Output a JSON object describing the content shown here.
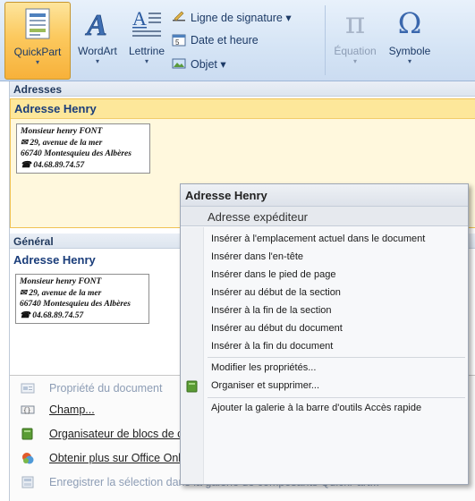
{
  "ribbon": {
    "quickpart": {
      "label": "QuickPart",
      "arrow": "▾"
    },
    "wordart": {
      "label": "WordArt",
      "arrow": "▾"
    },
    "lettrine": {
      "label": "Lettrine",
      "arrow": "▾"
    },
    "small_buttons": [
      "Ligne de signature ▾",
      "Date et heure",
      "Objet ▾"
    ],
    "equation": {
      "label": "Équation",
      "arrow": "▾"
    },
    "symbole": {
      "label": "Symbole",
      "arrow": "▾"
    },
    "pi_glyph": "π",
    "omega_glyph": "Ω"
  },
  "gallery": {
    "section_adresses": "Adresses",
    "section_general": "Général",
    "entry_title_1": "Adresse Henry",
    "entry_title_2": "Adresse Henry",
    "preview_lines": [
      "Monsieur henry FONT",
      "29, avenue de la mer",
      "66740 Montesquieu des Albères",
      "04.68.89.74.57"
    ],
    "preview_icons": [
      "✉",
      "☎"
    ]
  },
  "context_menu": {
    "title": "Adresse Henry",
    "subtitle": "Adresse expéditeur",
    "items": [
      "Insérer à l'emplacement actuel dans le document",
      "Insérer dans l'en-tête",
      "Insérer dans le pied de page",
      "Insérer au début de la section",
      "Insérer à la fin de la section",
      "Insérer au début du document",
      "Insérer à la fin du document",
      "Modifier les propriétés...",
      "Organiser et supprimer...",
      "Ajouter la galerie à la barre d'outils Accès rapide"
    ]
  },
  "bottom_menu": {
    "items": [
      "Propriété du document",
      "Champ...",
      "Organisateur de blocs de construction...",
      "Obtenir plus sur Office Online...",
      "Enregistrer la sélection dans la galerie de composants QuickPart..."
    ]
  },
  "colors": {
    "accent_orange": "#fcc95e",
    "ribbon_blue": "#d5e4f5",
    "title_blue": "#1a3d7a"
  }
}
